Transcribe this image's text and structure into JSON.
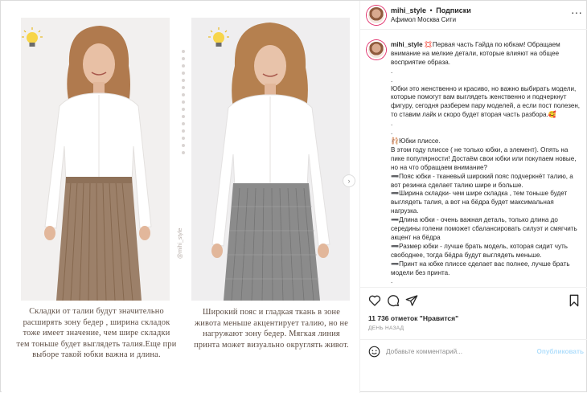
{
  "post": {
    "username": "mihi_style",
    "separator": "•",
    "follow_label": "Подписки",
    "location": "Афимол Москва Сити",
    "more_icon": "more-horizontal-icon"
  },
  "slides": {
    "caption_left": "Складки от талии будут значительно расширять зону бедер , ширина складок тоже имеет значение, чем шире складки тем тоньше будет выглядеть талия.Еще при выборе такой юбки важна и длина.",
    "caption_right": "Широкий пояс и гладкая ткань в зоне живота меньше акцентирует талию, но не нагружают зону бедер. Мягкая линия принта может визуально округлять живот.",
    "watermark": "@mihi_style",
    "skirt_left_color": "#9c8069",
    "skirt_right_color": "#8b8b8b"
  },
  "caption": {
    "username": "mihi_style",
    "body": " 💢Первая часть Гайда по юбкам! Обращаем внимание на мелкие детали, которые влияют на общее восприятие образа.\n.\n.\nЮбки это женственно и красиво, но важно выбирать модели, которые помогут вам выглядеть женственно и подчеркнут фигуру, сегодня разберем пару моделей, а если пост полезен, то ставим лайк и скоро будет вторая часть разбора.🥰\n.\n.\n🩰Юбки плиссе.\nВ этом году плиссе ( не только юбки, а элемент). Опять на пике популярности! Достаём свои юбки или покупаем новые, но на что обращаем внимание?\n➖Пояс юбки - тканевый широкий пояс подчеркнёт талию, а вот резинка сделает талию шире и больше.\n➖Ширина складки- чем шире складка , тем тоньше будет выглядеть талия, а вот на бёдра будет максимальная нагрузка.\n➖Длина юбки - очень важная деталь, только длина до середины голени поможет сбалансировать силуэт и смягчить акцент на бёдра\n➖Размер юбки - лучше брать модель, которая сидит чуть свободнее, тогда бёдра будут выглядеть меньше.\n➖Принт на юбке плиссе сделает вас полнее, лучше брать модели без принта.\n.\n.\n.\n🩰Юбки на запах .\nМодель хорошо смотрится с поясом, но есть важные моменты"
  },
  "footer": {
    "likes": "11 736 отметок \"Нравится\"",
    "posted": "ДЕНЬ НАЗАД",
    "comment_placeholder": "Добавьте комментарий...",
    "publish_label": "Опубликовать"
  }
}
